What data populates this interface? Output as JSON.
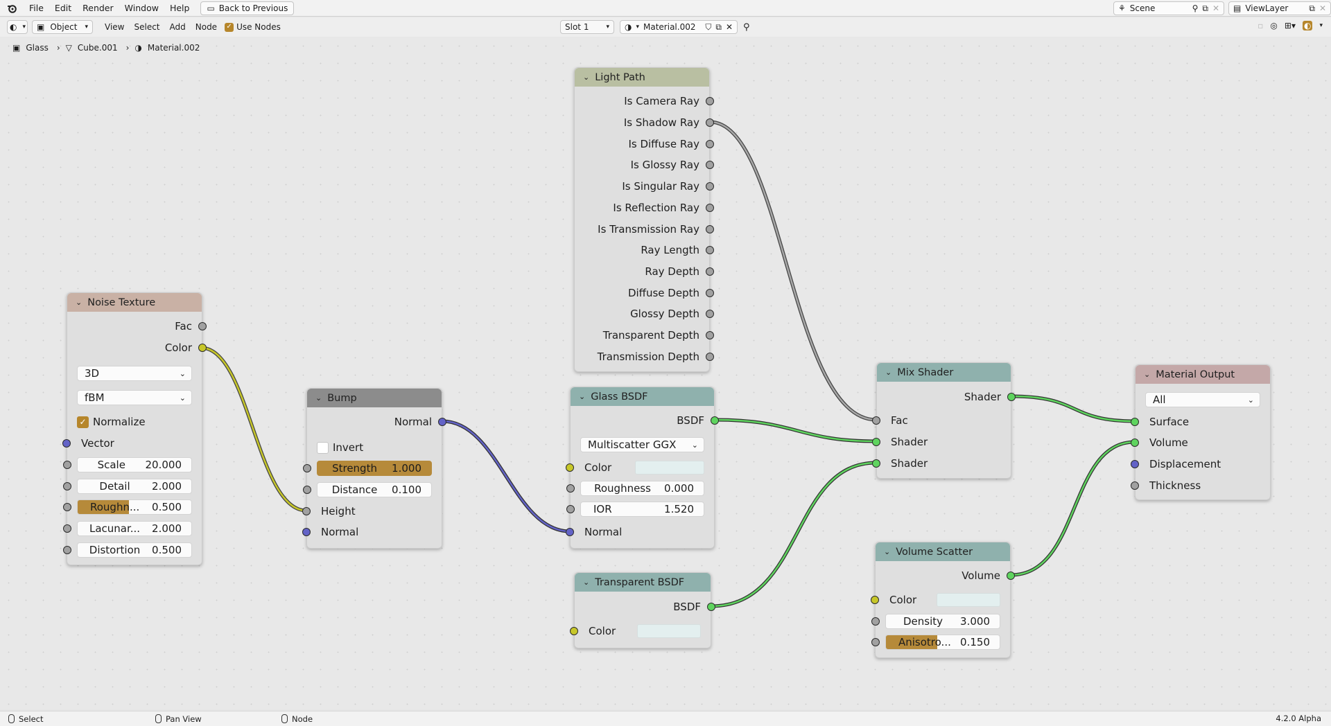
{
  "menu": {
    "file": "File",
    "edit": "Edit",
    "render": "Render",
    "window": "Window",
    "help": "Help",
    "back": "Back to Previous"
  },
  "top_right": {
    "scene": "Scene",
    "view_layer": "ViewLayer"
  },
  "toolbar": {
    "mode": "Object",
    "view": "View",
    "select": "Select",
    "add": "Add",
    "node": "Node",
    "use_nodes": "Use Nodes",
    "slot": "Slot 1",
    "material": "Material.002"
  },
  "breadcrumb": {
    "object": "Glass",
    "mesh": "Cube.001",
    "material": "Material.002"
  },
  "nodes": {
    "light_path": {
      "title": "Light Path",
      "outputs": [
        "Is Camera Ray",
        "Is Shadow Ray",
        "Is Diffuse Ray",
        "Is Glossy Ray",
        "Is Singular Ray",
        "Is Reflection Ray",
        "Is Transmission Ray",
        "Ray Length",
        "Ray Depth",
        "Diffuse Depth",
        "Glossy Depth",
        "Transparent Depth",
        "Transmission Depth"
      ]
    },
    "noise": {
      "title": "Noise Texture",
      "fac": "Fac",
      "color": "Color",
      "dimensions": "3D",
      "type": "fBM",
      "normalize": "Normalize",
      "vector": "Vector",
      "scale_label": "Scale",
      "scale": "20.000",
      "detail_label": "Detail",
      "detail": "2.000",
      "rough_label": "Roughn...",
      "rough": "0.500",
      "lac_label": "Lacunar...",
      "lac": "2.000",
      "dist_label": "Distortion",
      "dist": "0.500"
    },
    "bump": {
      "title": "Bump",
      "normal_out": "Normal",
      "invert": "Invert",
      "strength_label": "Strength",
      "strength": "1.000",
      "distance_label": "Distance",
      "distance": "0.100",
      "height": "Height",
      "normal_in": "Normal"
    },
    "glass": {
      "title": "Glass BSDF",
      "bsdf": "BSDF",
      "distribution": "Multiscatter GGX",
      "color": "Color",
      "rough_label": "Roughness",
      "rough": "0.000",
      "ior_label": "IOR",
      "ior": "1.520",
      "normal": "Normal"
    },
    "transparent": {
      "title": "Transparent BSDF",
      "bsdf": "BSDF",
      "color": "Color"
    },
    "mix": {
      "title": "Mix Shader",
      "shader_out": "Shader",
      "fac": "Fac",
      "shader1": "Shader",
      "shader2": "Shader"
    },
    "volume": {
      "title": "Volume Scatter",
      "volume_out": "Volume",
      "color": "Color",
      "density_label": "Density",
      "density": "3.000",
      "aniso_label": "Anisotro...",
      "aniso": "0.150"
    },
    "output": {
      "title": "Material Output",
      "target": "All",
      "surface": "Surface",
      "volume": "Volume",
      "displacement": "Displacement",
      "thickness": "Thickness"
    }
  },
  "statusbar": {
    "select": "Select",
    "pan": "Pan View",
    "node": "Node",
    "version": "4.2.0 Alpha"
  },
  "colors": {
    "header_input": "#c9b1a5",
    "header_converter": "#8c8c8c",
    "header_shader": "#8fb1ad",
    "header_output": "#c4a8a8",
    "header_light": "#b9bfa2",
    "accent": "#b68a3a"
  }
}
